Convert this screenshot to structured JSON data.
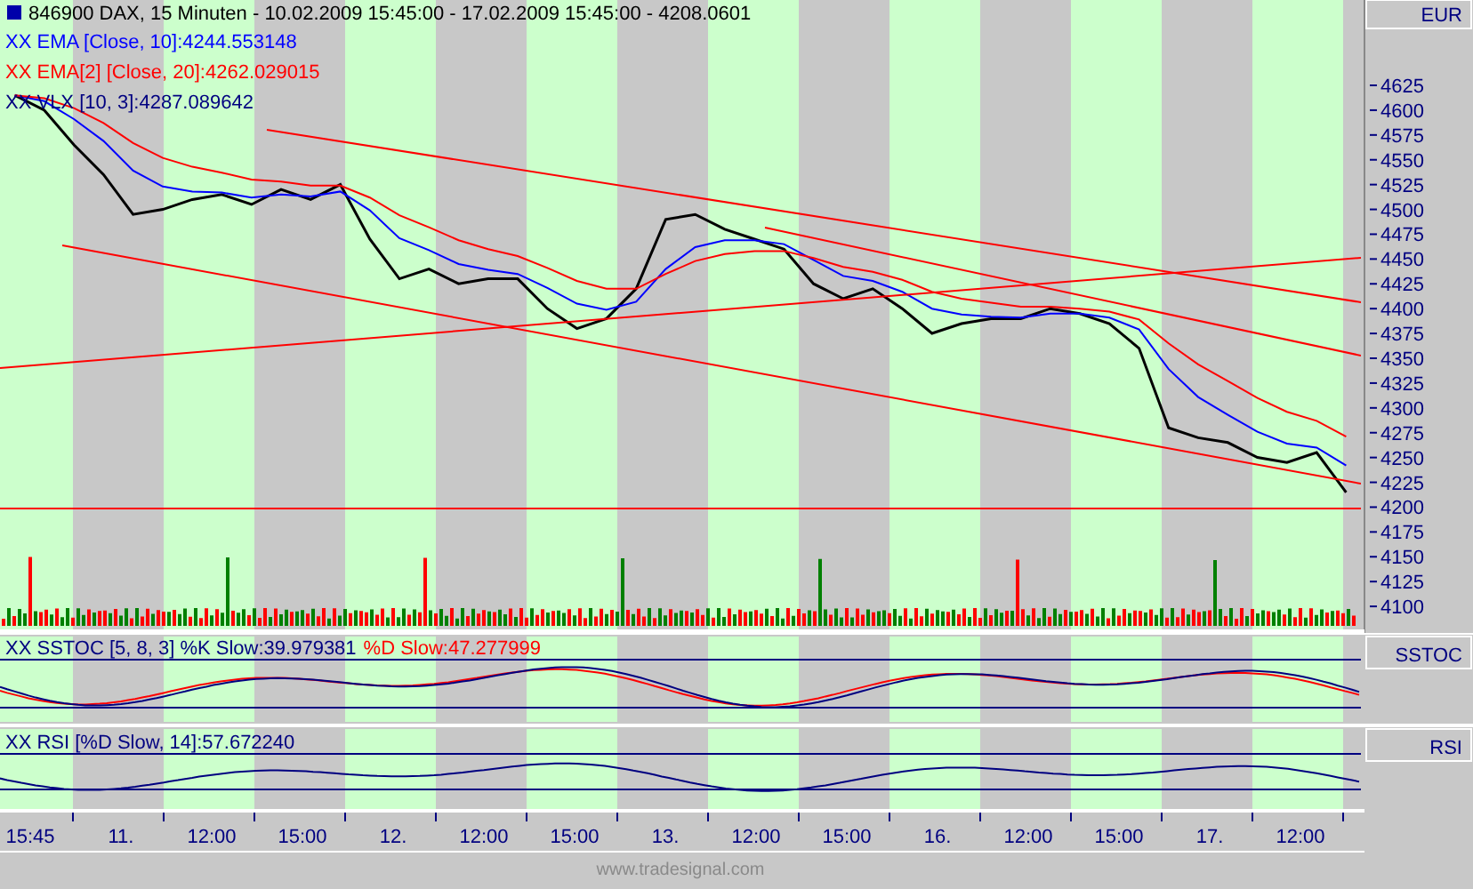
{
  "header": {
    "text": "846900  DAX, 15 Minuten - 10.02.2009 15:45:00 - 17.02.2009 15:45:00 - 4208.0601"
  },
  "price_panel": {
    "currency": "EUR",
    "legend": [
      {
        "text": "XX EMA [Close, 10]:4244.553148",
        "color": "#0000ff"
      },
      {
        "text": "XX EMA[2] [Close, 20]:4262.029015",
        "color": "#ff0000"
      },
      {
        "text": "XX VLX [10, 3]:4287.089642",
        "color": "#000080"
      }
    ],
    "chart_data": {
      "type": "line",
      "ylim": [
        4075,
        4711
      ],
      "series": [
        {
          "color": "#000000",
          "values": [
            4615,
            4600,
            4565,
            4535,
            4495,
            4500,
            4510,
            4515,
            4505,
            4520,
            4510,
            4525,
            4470,
            4430,
            4440,
            4425,
            4430,
            4430,
            4400,
            4380,
            4390,
            4420,
            4490,
            4495,
            4480,
            4470,
            4460,
            4425,
            4410,
            4420,
            4400,
            4375,
            4385,
            4390,
            4390,
            4400,
            4395,
            4385,
            4360,
            4280,
            4270,
            4265,
            4250,
            4245,
            4255,
            4215
          ]
        },
        {
          "color": "#0000ff",
          "values": [
            4615,
            4609,
            4591,
            4569,
            4539,
            4523,
            4518,
            4517,
            4512,
            4515,
            4513,
            4518,
            4499,
            4471,
            4459,
            4445,
            4439,
            4435,
            4421,
            4405,
            4399,
            4407,
            4440,
            4462,
            4469,
            4469,
            4465,
            4449,
            4433,
            4428,
            4417,
            4400,
            4394,
            4392,
            4391,
            4395,
            4395,
            4391,
            4379,
            4339,
            4311,
            4293,
            4276,
            4264,
            4260,
            4242
          ]
        },
        {
          "color": "#ff0000",
          "values": [
            4615,
            4612,
            4602,
            4587,
            4567,
            4552,
            4543,
            4537,
            4530,
            4528,
            4524,
            4524,
            4512,
            4494,
            4482,
            4469,
            4460,
            4453,
            4441,
            4428,
            4420,
            4420,
            4435,
            4448,
            4455,
            4458,
            4458,
            4451,
            4442,
            4437,
            4429,
            4417,
            4410,
            4406,
            4402,
            4402,
            4400,
            4397,
            4389,
            4365,
            4344,
            4327,
            4310,
            4296,
            4287,
            4271
          ]
        }
      ],
      "yticks": [
        4100,
        4125,
        4150,
        4175,
        4200,
        4225,
        4250,
        4275,
        4300,
        4325,
        4350,
        4375,
        4400,
        4425,
        4450,
        4475,
        4500,
        4525,
        4550,
        4575,
        4600,
        4625
      ]
    }
  },
  "time_axis": {
    "labels": [
      "15:45",
      "11.",
      "12:00",
      "15:00",
      "12.",
      "12:00",
      "15:00",
      "13.",
      "12:00",
      "15:00",
      "16.",
      "12:00",
      "15:00",
      "17.",
      "12:00"
    ]
  },
  "sstoc_panel": {
    "label": "SSTOC",
    "legend": [
      {
        "text": "XX SSTOC [5, 8, 3] %K Slow:39.979381",
        "color": "#000080"
      },
      {
        "text": "%D Slow:47.277999",
        "color": "#ff0000"
      }
    ]
  },
  "rsi_panel": {
    "label": "RSI",
    "legend": [
      {
        "text": "XX RSI [%D Slow, 14]:57.672240",
        "color": "#000080"
      }
    ]
  },
  "footer": "www.tradesignal.com"
}
